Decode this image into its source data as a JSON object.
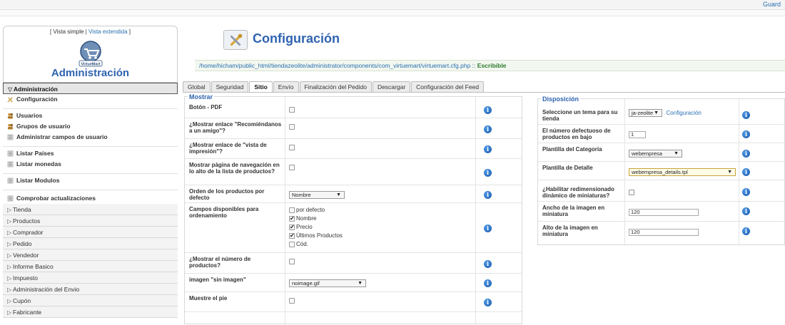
{
  "topbar": {
    "save_label": "Guard"
  },
  "sidebar": {
    "views_simple": "[ Vista simple |",
    "views_extended": "Vista extendida",
    "views_close": "]",
    "logo_text": "VirtueMart",
    "title": "Administración",
    "section_admin": "Administración",
    "admin_items": [
      "Configuración"
    ],
    "user_items": [
      "Usuarios",
      "Grupos de usuario",
      "Administrar campos de usuario"
    ],
    "list_items": [
      "Listar Países",
      "Listar monedas"
    ],
    "module_items": [
      "Listar Modulos"
    ],
    "update_items": [
      "Comprobar actualizaciones"
    ],
    "sections": [
      "Tienda",
      "Productos",
      "Comprador",
      "Pedido",
      "Vendedor",
      "Informe Basico",
      "Impuesto",
      "Administración del Envio",
      "Cupón",
      "Fabricante"
    ]
  },
  "main": {
    "title": "Configuración",
    "path": "/home/hicham/public_html/tiendazeolite/administrator/components/com_virtuemart/virtuemart.cfg.php ::",
    "path_status": "Escribible",
    "tabs": [
      "Global",
      "Seguridad",
      "Sitio",
      "Envío",
      "Finalización del Pedido",
      "Descargar",
      "Configuración del Feed"
    ],
    "active_tab": "Sitio"
  },
  "mostrar": {
    "legend": "Mostrar",
    "rows": [
      {
        "label": "Botón - PDF"
      },
      {
        "label": "¿Mostrar enlace \"Recomiéndanos a un amigo\"?"
      },
      {
        "label": "¿Mostrar enlace de \"vista de impresión\"?"
      },
      {
        "label": "Mostrar página de navegación en lo alto de la lista de productos?"
      },
      {
        "label": "Orden de los productos por defecto",
        "select": "Nombre"
      },
      {
        "label": "Campos disponibles para ordenamiento",
        "options": [
          {
            "label": "por defecto",
            "checked": false
          },
          {
            "label": "Nombre",
            "checked": true
          },
          {
            "label": "Precio",
            "checked": true
          },
          {
            "label": "Últimos Productos",
            "checked": true
          },
          {
            "label": "Cód.",
            "checked": false
          }
        ]
      },
      {
        "label": "¿Mostrar el número de productos?"
      },
      {
        "label": "imagen \"sin imagen\"",
        "select": "noimage.gif"
      },
      {
        "label": "Muestre el pie"
      }
    ]
  },
  "disposicion": {
    "legend": "Disposición",
    "theme_label": "Seleccione un tema para su tienda",
    "theme_value": "ja-zeolite",
    "theme_link": "Configuración",
    "rows_label": "El número defectuoso de productos en bajo",
    "rows_value": "1",
    "cat_label": "Plantilla del Categoría",
    "cat_value": "webempresa",
    "detail_label": "Plantilla de Detalle",
    "detail_value": "webempresa_details.tpl",
    "resize_label": "¿Habilitar redimensionado dinámico de miniaturas?",
    "width_label": "Ancho de la imagen en miniatura",
    "width_value": "120",
    "height_label": "Alto de la imagen en miniatura",
    "height_value": "120"
  },
  "icons": {
    "info": "info-icon",
    "colors": {
      "accent": "#2e63b0",
      "ok": "#2b7a2b"
    }
  }
}
